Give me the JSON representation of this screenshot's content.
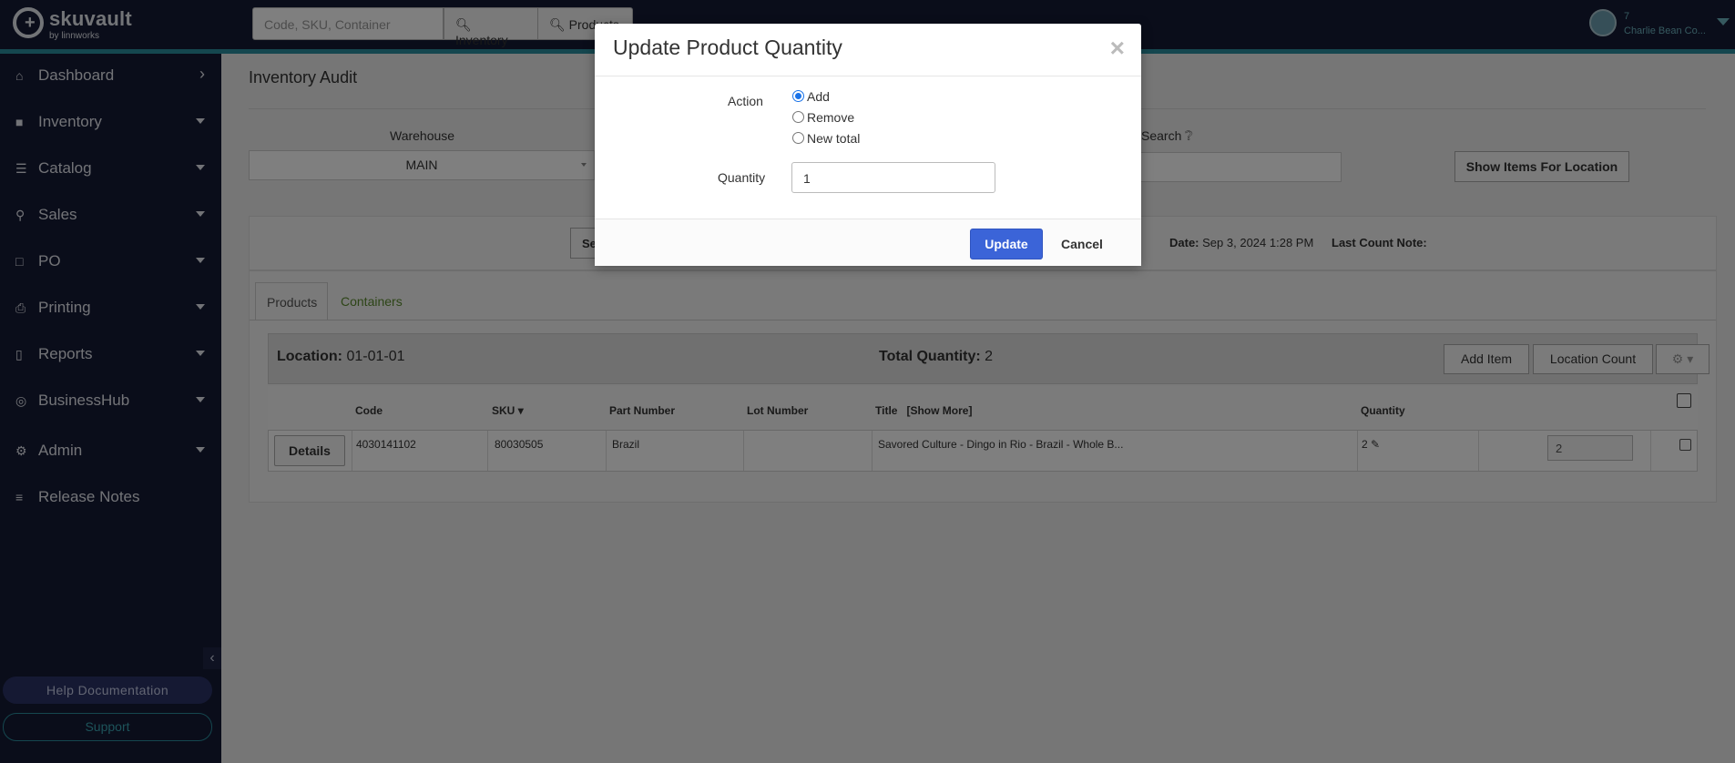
{
  "brand": {
    "name": "skuvault",
    "by": "by linnworks"
  },
  "topbar": {
    "search_placeholder": "Code, SKU, Container",
    "inventory_btn": "Inventory",
    "products_btn": "Products"
  },
  "user": {
    "line1": "7",
    "line2": "Charlie Bean Co..."
  },
  "sidebar": {
    "items": [
      {
        "label": "Dashboard",
        "icon": "home-icon"
      },
      {
        "label": "Inventory",
        "icon": "briefcase-icon"
      },
      {
        "label": "Catalog",
        "icon": "catalog-icon"
      },
      {
        "label": "Sales",
        "icon": "cart-icon"
      },
      {
        "label": "PO",
        "icon": "document-icon"
      },
      {
        "label": "Printing",
        "icon": "printer-icon"
      },
      {
        "label": "Reports",
        "icon": "chart-icon"
      },
      {
        "label": "BusinessHub",
        "icon": "hub-icon"
      },
      {
        "label": "Admin",
        "icon": "gears-icon"
      },
      {
        "label": "Release Notes",
        "icon": "list-icon"
      }
    ],
    "help": "Help Documentation",
    "support": "Support"
  },
  "page": {
    "title": "Inventory Audit",
    "warehouse_label": "Warehouse",
    "warehouse_value": "MAIN",
    "search_label": "Search",
    "show_items_btn": "Show Items For Location",
    "info_btn": "Se",
    "last_date_label": "Date:",
    "last_date_value": "Sep 3, 2024 1:28 PM",
    "last_count_note": "Last Count Note:"
  },
  "tabs": {
    "products": "Products",
    "containers": "Containers"
  },
  "location": {
    "label": "Location:",
    "value": "01-01-01",
    "total_label": "Total Quantity:",
    "total_value": "2",
    "add_item_btn": "Add Item",
    "location_count_btn": "Location Count"
  },
  "table": {
    "headers": {
      "code": "Code",
      "sku": "SKU",
      "part_number": "Part Number",
      "lot_number": "Lot Number",
      "title": "Title",
      "show_more": "[Show More]",
      "quantity": "Quantity"
    },
    "row": {
      "details_btn": "Details",
      "code": "4030141102",
      "sku": "80030505",
      "part_number": "Brazil",
      "lot_number": "",
      "title": "Savored Culture - Dingo in Rio - Brazil - Whole B...",
      "quantity": "2",
      "count_input": "2"
    }
  },
  "modal": {
    "title": "Update Product Quantity",
    "action_label": "Action",
    "options": [
      "Add",
      "Remove",
      "New total"
    ],
    "selected": "Add",
    "quantity_label": "Quantity",
    "quantity_value": "1",
    "update_btn": "Update",
    "cancel_btn": "Cancel"
  }
}
